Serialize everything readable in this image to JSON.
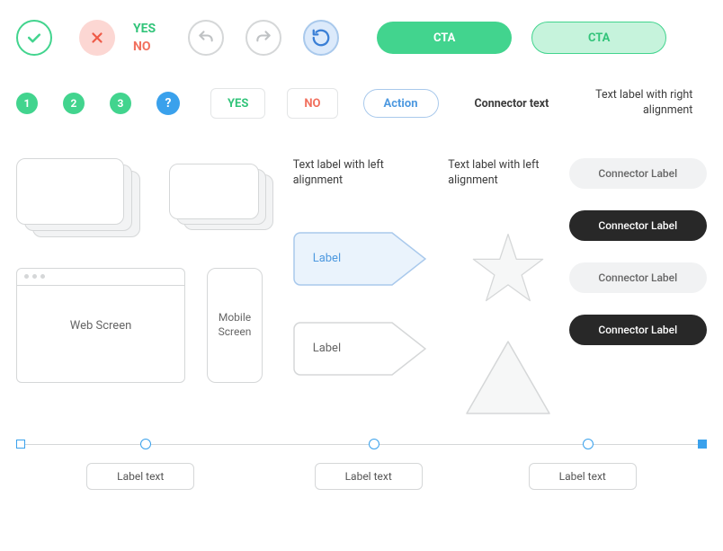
{
  "row1": {
    "yes": "YES",
    "no": "NO",
    "cta_solid": "CTA",
    "cta_outline": "CTA"
  },
  "row2": {
    "step1": "1",
    "step2": "2",
    "step3": "3",
    "help": "?",
    "chip_yes": "YES",
    "chip_no": "NO",
    "action": "Action",
    "connector_text": "Connector text",
    "right_label": "Text label with right alignment"
  },
  "main": {
    "left_label_1": "Text label with left alignment",
    "left_label_2": "Text label with left alignment",
    "web_screen": "Web Screen",
    "mobile_screen": "Mobile Screen",
    "tag_blue": "Label",
    "tag_grey": "Label",
    "connector_labels": [
      "Connector Label",
      "Connector Label",
      "Connector Label",
      "Connector Label"
    ]
  },
  "timeline": {
    "labels": [
      "Label text",
      "Label text",
      "Label text"
    ]
  }
}
